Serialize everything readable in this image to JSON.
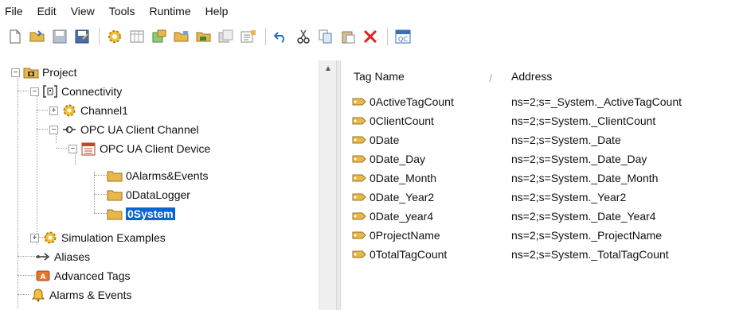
{
  "menu": [
    "File",
    "Edit",
    "View",
    "Tools",
    "Runtime",
    "Help"
  ],
  "toolbar": {
    "icons": [
      "new-file-icon",
      "open-folder-icon",
      "save-icon",
      "save-as-icon",
      "gear-icon",
      "table-icon",
      "new-channel-icon",
      "new-device-icon",
      "new-tag-group-icon",
      "duplicate-icon",
      "properties-icon",
      "undo-icon",
      "cut-icon",
      "copy-icon",
      "paste-icon",
      "delete-icon",
      "quick-client-icon"
    ]
  },
  "tree": {
    "project": "Project",
    "connectivity": "Connectivity",
    "channel1": "Channel1",
    "opc_channel": "OPC UA Client Channel",
    "opc_device": "OPC UA Client Device",
    "alarms_events_group": "0Alarms&Events",
    "datalogger_group": "0DataLogger",
    "system_group": "0System",
    "simulation": "Simulation Examples",
    "aliases": "Aliases",
    "advanced_tags": "Advanced Tags",
    "alarms_events": "Alarms & Events"
  },
  "list": {
    "col_tag": "Tag Name",
    "col_sort": "/",
    "col_address": "Address",
    "rows": [
      {
        "name": "0ActiveTagCount",
        "address": "ns=2;s=_System._ActiveTagCount"
      },
      {
        "name": "0ClientCount",
        "address": "ns=2;s=System._ClientCount"
      },
      {
        "name": "0Date",
        "address": "ns=2;s=System._Date"
      },
      {
        "name": "0Date_Day",
        "address": "ns=2;s=System._Date_Day"
      },
      {
        "name": "0Date_Month",
        "address": "ns=2;s=System._Date_Month"
      },
      {
        "name": "0Date_Year2",
        "address": "ns=2;s=System._Year2"
      },
      {
        "name": "0Date_year4",
        "address": "ns=2;s=System._Date_Year4"
      },
      {
        "name": "0ProjectName",
        "address": "ns=2;s=System._ProjectName"
      },
      {
        "name": "0TotalTagCount",
        "address": "ns=2;s=System._TotalTagCount"
      }
    ]
  },
  "colors": {
    "selection": "#0a64d6",
    "folder": "#e8b84a",
    "delete": "#e02020"
  }
}
